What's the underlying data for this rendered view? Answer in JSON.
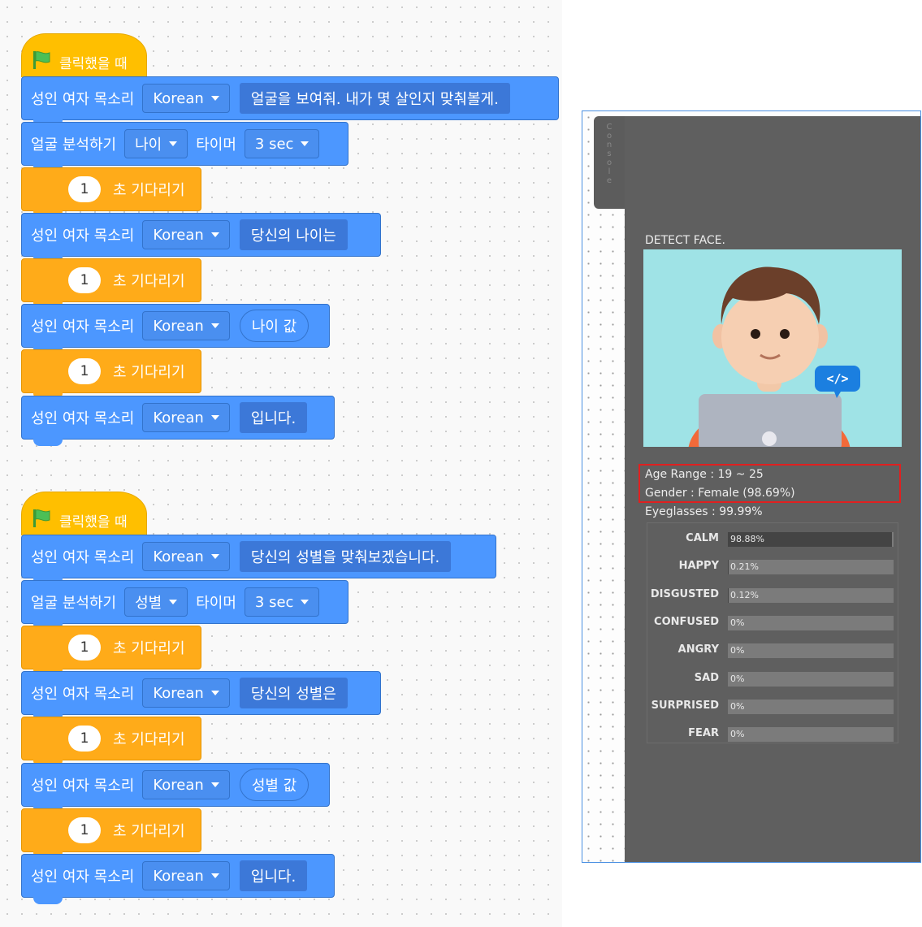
{
  "script1": {
    "hat_label": "클릭했을 때",
    "blocks": [
      {
        "label": "성인 여자 목소리",
        "dropdown": "Korean",
        "text": "얼굴을 보여줘. 내가 몇 살인지 맞춰볼게."
      },
      {
        "label": "얼굴 분석하기",
        "dropdown": "나이",
        "label2": "타이머",
        "dropdown2": "3 sec"
      },
      {
        "num": "1",
        "label": "초 기다리기"
      },
      {
        "label": "성인 여자 목소리",
        "dropdown": "Korean",
        "text": "당신의 나이는"
      },
      {
        "num": "1",
        "label": "초 기다리기"
      },
      {
        "label": "성인 여자 목소리",
        "dropdown": "Korean",
        "text": "나이 값"
      },
      {
        "num": "1",
        "label": "초 기다리기"
      },
      {
        "label": "성인 여자 목소리",
        "dropdown": "Korean",
        "text": "입니다."
      }
    ]
  },
  "script2": {
    "hat_label": "클릭했을 때",
    "blocks": [
      {
        "label": "성인 여자 목소리",
        "dropdown": "Korean",
        "text": "당신의 성별을 맞춰보겠습니다."
      },
      {
        "label": "얼굴 분석하기",
        "dropdown": "성별",
        "label2": "타이머",
        "dropdown2": "3 sec"
      },
      {
        "num": "1",
        "label": "초 기다리기"
      },
      {
        "label": "성인 여자 목소리",
        "dropdown": "Korean",
        "text": "당신의 성별은"
      },
      {
        "num": "1",
        "label": "초 기다리기"
      },
      {
        "label": "성인 여자 목소리",
        "dropdown": "Korean",
        "text": "성별 값"
      },
      {
        "num": "1",
        "label": "초 기다리기"
      },
      {
        "label": "성인 여자 목소리",
        "dropdown": "Korean",
        "text": "입니다."
      }
    ]
  },
  "console": {
    "tab_label": "Console",
    "detect_title": "DETECT FACE.",
    "age_range": "Age Range : 19 ~ 25",
    "gender": "Gender : Female (98.69%)",
    "eyeglasses": "Eyeglasses : 99.99%",
    "code_badge": "</>",
    "emotions": [
      {
        "name": "CALM",
        "value": "98.88%",
        "fraction": 0.9888
      },
      {
        "name": "HAPPY",
        "value": "0.21%",
        "fraction": 0.0021
      },
      {
        "name": "DISGUSTED",
        "value": "0.12%",
        "fraction": 0.0012
      },
      {
        "name": "CONFUSED",
        "value": "0%",
        "fraction": 0
      },
      {
        "name": "ANGRY",
        "value": "0%",
        "fraction": 0
      },
      {
        "name": "SAD",
        "value": "0%",
        "fraction": 0
      },
      {
        "name": "SURPRISED",
        "value": "0%",
        "fraction": 0
      },
      {
        "name": "FEAR",
        "value": "0%",
        "fraction": 0
      }
    ]
  }
}
